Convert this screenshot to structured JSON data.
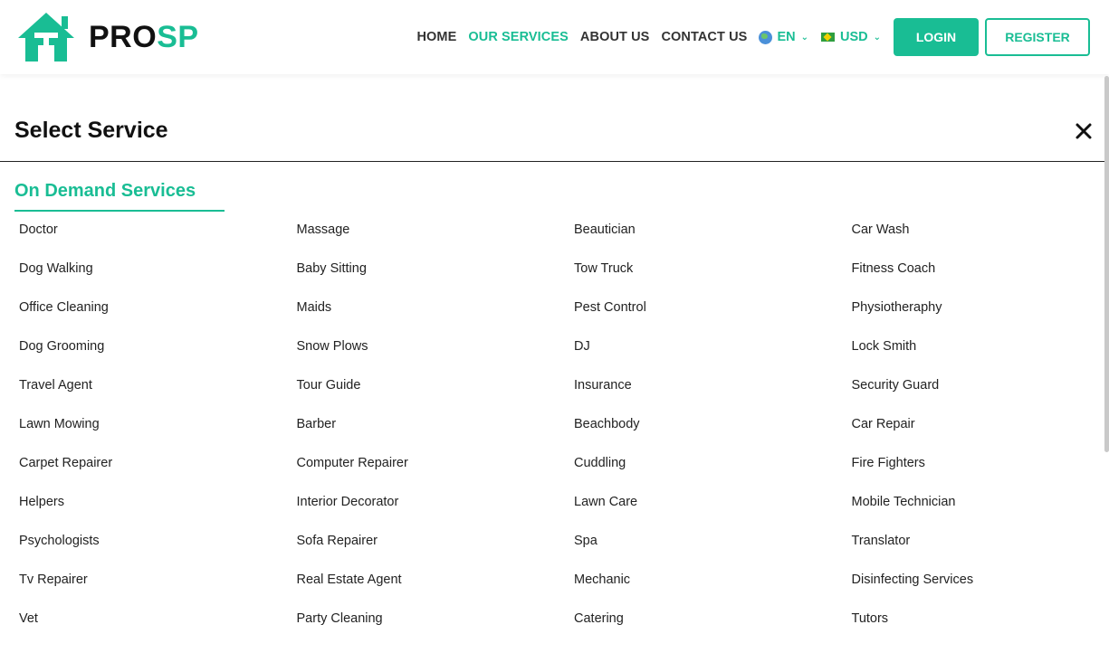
{
  "brand": {
    "name_part1": "PRO",
    "name_part2": "SP",
    "accent_color": "#19bd94"
  },
  "nav": {
    "links": [
      {
        "label": "HOME",
        "active": false
      },
      {
        "label": "OUR SERVICES",
        "active": true
      },
      {
        "label": "ABOUT US",
        "active": false
      },
      {
        "label": "CONTACT US",
        "active": false
      }
    ],
    "language": {
      "icon": "globe-icon",
      "value": "EN"
    },
    "currency": {
      "icon": "flag-icon",
      "value": "USD"
    },
    "login_label": "LOGIN",
    "register_label": "REGISTER"
  },
  "panel": {
    "title": "Select Service",
    "section_title": "On Demand Services",
    "services": [
      [
        "Doctor",
        "Massage",
        "Beautician",
        "Car Wash"
      ],
      [
        "Dog Walking",
        "Baby Sitting",
        "Tow Truck",
        "Fitness Coach"
      ],
      [
        "Office Cleaning",
        "Maids",
        "Pest Control",
        "Physiotheraphy"
      ],
      [
        "Dog Grooming",
        "Snow Plows",
        "DJ",
        "Lock Smith"
      ],
      [
        "Travel Agent",
        "Tour Guide",
        "Insurance",
        "Security Guard"
      ],
      [
        "Lawn Mowing",
        "Barber",
        "Beachbody",
        "Car Repair"
      ],
      [
        "Carpet Repairer",
        "Computer Repairer",
        "Cuddling",
        "Fire Fighters"
      ],
      [
        "Helpers",
        "Interior Decorator",
        "Lawn Care",
        "Mobile Technician"
      ],
      [
        "Psychologists",
        "Sofa Repairer",
        "Spa",
        "Translator"
      ],
      [
        "Tv Repairer",
        "Real Estate Agent",
        "Mechanic",
        "Disinfecting Services"
      ],
      [
        "Vet",
        "Party Cleaning",
        "Catering",
        "Tutors"
      ]
    ]
  }
}
